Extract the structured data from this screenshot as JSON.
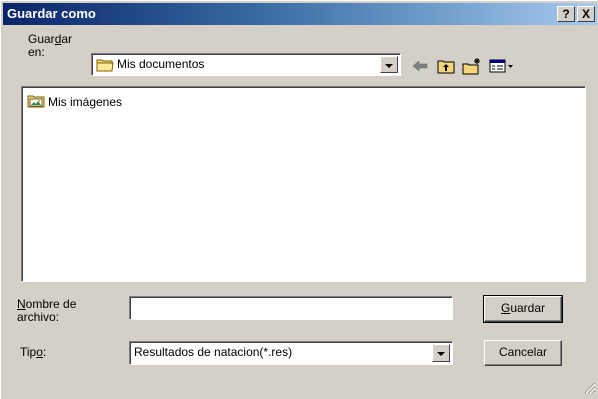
{
  "window": {
    "title": "Guardar como",
    "help_label": "?",
    "close_label": "X"
  },
  "save_in": {
    "label_line1_pre": "Guar",
    "label_line1_key": "d",
    "label_line1_post": "ar",
    "label_line2": "en:",
    "value": "Mis documentos",
    "icon": "folder-icon"
  },
  "toolbar": {
    "back_icon": "back-arrow-icon",
    "up_icon": "up-folder-icon",
    "new_folder_icon": "new-folder-icon",
    "view_icon": "view-menu-icon"
  },
  "file_list": {
    "items": [
      {
        "label": "Mis imágenes",
        "icon": "pictures-folder-icon"
      }
    ]
  },
  "filename": {
    "label_line1_key": "N",
    "label_line1_post": "ombre de",
    "label_line2": "archivo:",
    "value": ""
  },
  "filetype": {
    "label_pre": "Tip",
    "label_key": "o",
    "label_post": ":",
    "value": "Resultados de natacion(*.res)"
  },
  "buttons": {
    "save_key": "G",
    "save_rest": "uardar",
    "cancel": "Cancelar"
  },
  "colors": {
    "titlebar_start": "#0a246a",
    "titlebar_end": "#a6caf0",
    "face": "#d4d0c8"
  }
}
